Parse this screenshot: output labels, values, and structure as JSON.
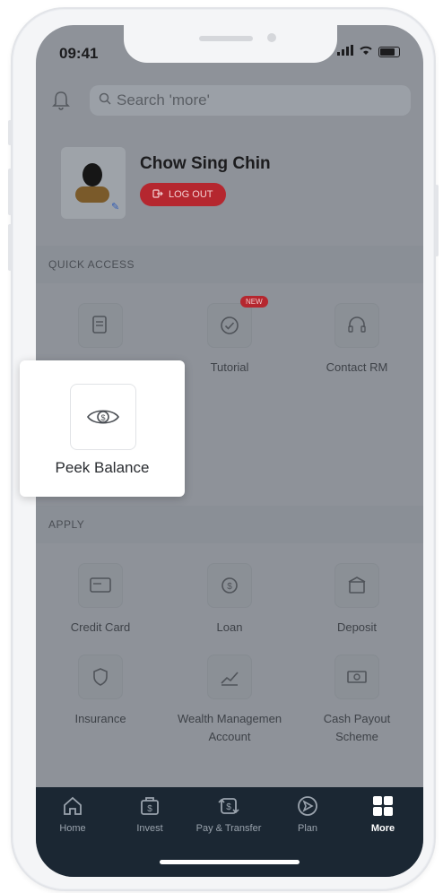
{
  "status_bar": {
    "time": "09:41"
  },
  "search": {
    "placeholder": "Search 'more'"
  },
  "profile": {
    "name": "Chow Sing Chin",
    "logout_label": "LOG OUT"
  },
  "quick_access": {
    "header": "QUICK ACCESS",
    "items": [
      {
        "label": "Tutorial",
        "badge": "NEW",
        "icon": "check-circle-icon"
      },
      {
        "label": "Contact RM",
        "icon": "headset-icon"
      }
    ],
    "peek": {
      "label": "Peek Balance",
      "icon": "eye-dollar-icon"
    }
  },
  "apply": {
    "header": "APPLY",
    "items": [
      {
        "label": "Credit Card",
        "icon": "credit-card-icon"
      },
      {
        "label": "Loan",
        "icon": "loan-icon"
      },
      {
        "label": "Deposit",
        "icon": "deposit-icon"
      },
      {
        "label": "Insurance",
        "icon": "insurance-icon"
      },
      {
        "label": "Wealth Managemen",
        "label2": "Account",
        "icon": "wealth-icon"
      },
      {
        "label": "Cash Payout",
        "label2": "Scheme",
        "icon": "cash-payout-icon"
      }
    ]
  },
  "nav": {
    "items": [
      {
        "label": "Home",
        "icon": "home-icon"
      },
      {
        "label": "Invest",
        "icon": "invest-icon"
      },
      {
        "label": "Pay & Transfer",
        "icon": "pay-transfer-icon"
      },
      {
        "label": "Plan",
        "icon": "plan-icon"
      },
      {
        "label": "More",
        "icon": "grid-icon",
        "active": true
      }
    ]
  },
  "colors": {
    "accent_red": "#b5272f",
    "nav_bg": "#1b2733",
    "overlay": "#8e9299"
  }
}
